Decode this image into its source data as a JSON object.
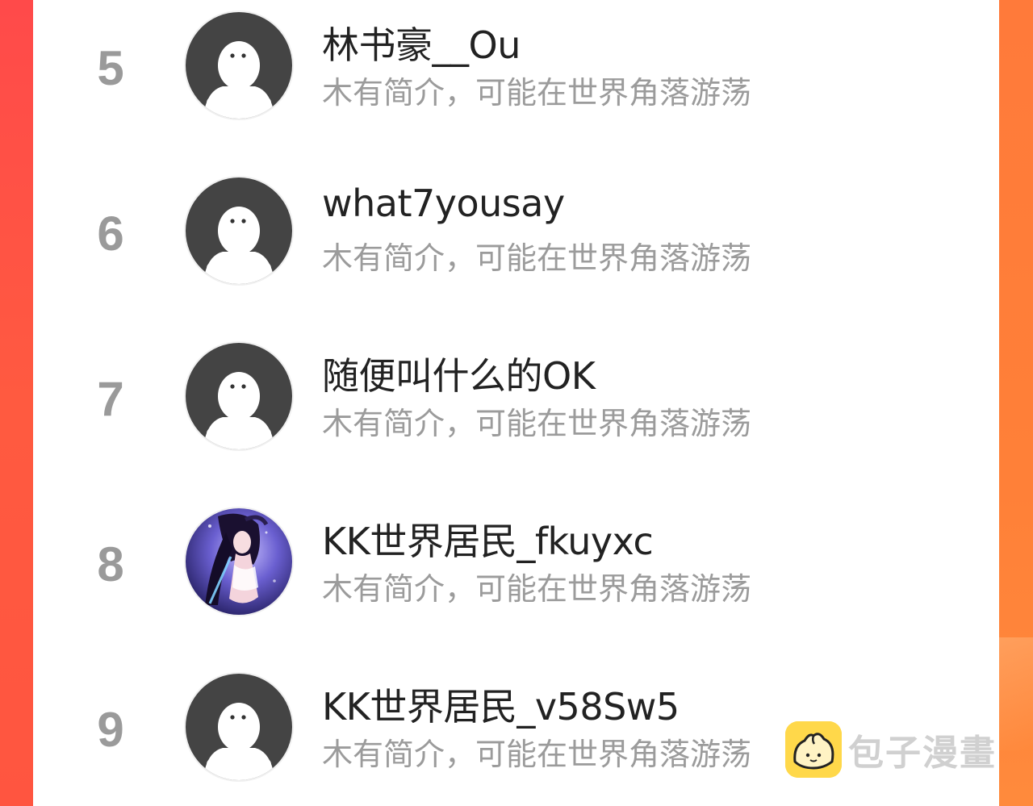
{
  "users": [
    {
      "rank": "5",
      "name": "林书豪__Ou",
      "bio": "木有简介，可能在世界角落游荡",
      "avatar": "default-avatar"
    },
    {
      "rank": "6",
      "name": "what7yousay",
      "bio": "木有简介，可能在世界角落游荡",
      "avatar": "default-avatar"
    },
    {
      "rank": "7",
      "name": "随便叫什么的OK",
      "bio": "木有简介，可能在世界角落游荡",
      "avatar": "default-avatar"
    },
    {
      "rank": "8",
      "name": "KK世界居民_fkuyxc",
      "bio": "木有简介，可能在世界角落游荡",
      "avatar": "anime-girl-avatar"
    },
    {
      "rank": "9",
      "name": "KK世界居民_v58Sw5",
      "bio": "木有简介，可能在世界角落游荡",
      "avatar": "default-avatar"
    }
  ],
  "watermark": {
    "text": "包子漫畫",
    "icon": "bun-mascot-icon"
  },
  "colors": {
    "rank": "#9a9a9a",
    "name": "#222222",
    "bio": "#9b9b9b",
    "frame_left": "#ff4a45",
    "frame_right": "#ff8a3a"
  }
}
